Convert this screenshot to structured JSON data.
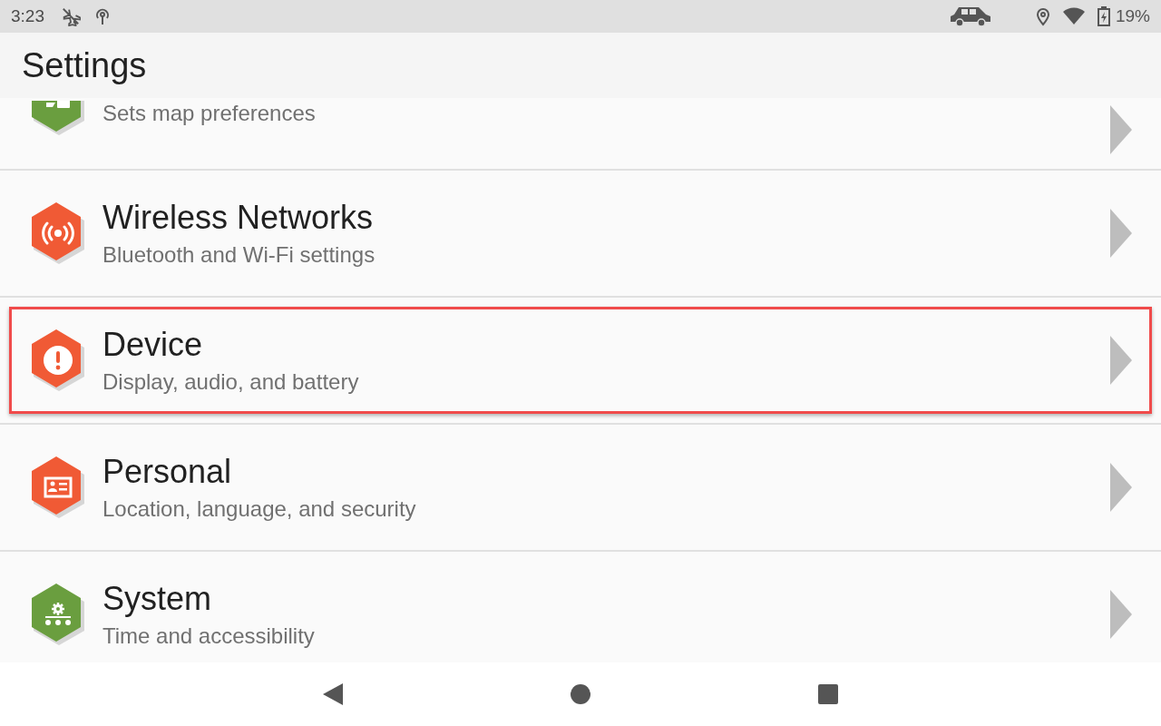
{
  "status_bar": {
    "time": "3:23",
    "battery": "19%"
  },
  "header": {
    "title": "Settings"
  },
  "items": [
    {
      "kind": "clipped",
      "subtitle": "Sets map preferences",
      "color": "#6a9e3f",
      "selected": false
    },
    {
      "kind": "full",
      "title": "Wireless Networks",
      "subtitle": "Bluetooth and Wi-Fi settings",
      "color": "#f05a35",
      "selected": false
    },
    {
      "kind": "full",
      "title": "Device",
      "subtitle": "Display, audio, and battery",
      "color": "#f05a35",
      "selected": true
    },
    {
      "kind": "full",
      "title": "Personal",
      "subtitle": "Location, language, and security",
      "color": "#f05a35",
      "selected": false
    },
    {
      "kind": "full",
      "title": "System",
      "subtitle": "Time and accessibility",
      "color": "#6a9e3f",
      "selected": false
    }
  ]
}
